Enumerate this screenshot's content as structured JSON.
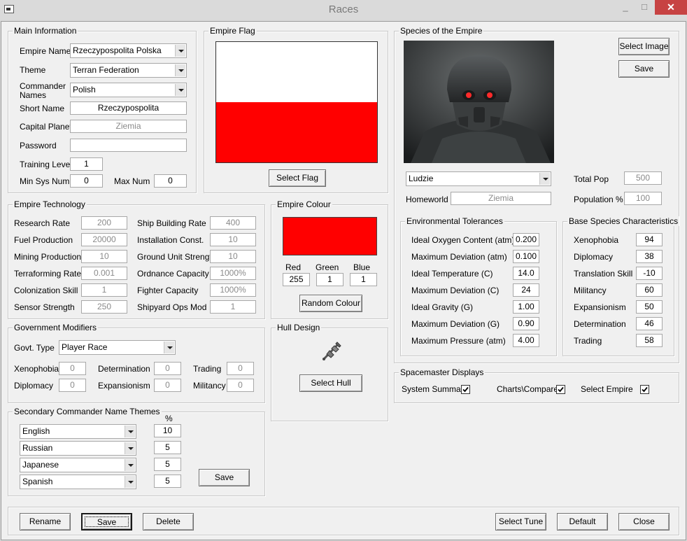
{
  "window": {
    "title": "Races",
    "minimize": "_",
    "maximize": "□",
    "close": "✕"
  },
  "main_info": {
    "title": "Main Information",
    "empire_name_label": "Empire Name",
    "empire_name": "Rzeczypospolita Polska",
    "theme_label": "Theme",
    "theme": "Terran Federation",
    "commander_names_label_1": "Commander",
    "commander_names_label_2": "Names",
    "commander_names": "Polish",
    "short_name_label": "Short Name",
    "short_name": "Rzeczypospolita",
    "capital_label": "Capital Planet",
    "capital": "Ziemia",
    "password_label": "Password",
    "password": "",
    "training_label": "Training Level",
    "training": "1",
    "min_sys_label": "Min Sys Num",
    "min_sys": "0",
    "max_num_label": "Max Num",
    "max_num": "0"
  },
  "empire_flag": {
    "title": "Empire Flag",
    "select_button": "Select Flag",
    "colors": {
      "top": "#ffffff",
      "bottom": "#ff0000"
    }
  },
  "species": {
    "title": "Species of the Empire",
    "select_image_button": "Select Image",
    "save_button": "Save",
    "image_icon": "armored-soldier-portrait",
    "species_name": "Ludzie",
    "homeworld_label": "Homeworld",
    "homeworld": "Ziemia",
    "total_pop_label": "Total Pop",
    "total_pop": "500",
    "population_pct_label": "Population %",
    "population_pct": "100"
  },
  "env_tolerances": {
    "title": "Environmental Tolerances",
    "rows": [
      {
        "label": "Ideal Oxygen Content (atm)",
        "value": "0.200"
      },
      {
        "label": "Maximum Deviation (atm)",
        "value": "0.100"
      },
      {
        "label": "Ideal Temperature (C)",
        "value": "14.0"
      },
      {
        "label": "Maximum Deviation (C)",
        "value": "24"
      },
      {
        "label": "Ideal Gravity (G)",
        "value": "1.00"
      },
      {
        "label": "Maximum Deviation (G)",
        "value": "0.90"
      },
      {
        "label": "Maximum Pressure (atm)",
        "value": "4.00"
      }
    ]
  },
  "base_species": {
    "title": "Base Species Characteristics",
    "rows": [
      {
        "label": "Xenophobia",
        "value": "94"
      },
      {
        "label": "Diplomacy",
        "value": "38"
      },
      {
        "label": "Translation Skill",
        "value": "-10"
      },
      {
        "label": "Militancy",
        "value": "60"
      },
      {
        "label": "Expansionism",
        "value": "50"
      },
      {
        "label": "Determination",
        "value": "46"
      },
      {
        "label": "Trading",
        "value": "58"
      }
    ]
  },
  "tech": {
    "title": "Empire Technology",
    "left": [
      {
        "label": "Research Rate",
        "value": "200"
      },
      {
        "label": "Fuel Production",
        "value": "20000"
      },
      {
        "label": "Mining Production",
        "value": "10"
      },
      {
        "label": "Terraforming Rate",
        "value": "0.001"
      },
      {
        "label": "Colonization Skill",
        "value": "1"
      },
      {
        "label": "Sensor Strength",
        "value": "250"
      }
    ],
    "right": [
      {
        "label": "Ship Building Rate",
        "value": "400"
      },
      {
        "label": "Installation Const.",
        "value": "10"
      },
      {
        "label": "Ground Unit Strength",
        "value": "10"
      },
      {
        "label": "Ordnance Capacity",
        "value": "1000%"
      },
      {
        "label": "Fighter Capacity",
        "value": "1000%"
      },
      {
        "label": "Shipyard Ops Mod",
        "value": "1"
      }
    ]
  },
  "empire_colour": {
    "title": "Empire Colour",
    "swatch_color": "#ff0000",
    "red_label": "Red",
    "red": "255",
    "green_label": "Green",
    "green": "1",
    "blue_label": "Blue",
    "blue": "1",
    "random_button": "Random Colour"
  },
  "gov": {
    "title": "Government Modifiers",
    "type_label": "Govt. Type",
    "type": "Player Race",
    "xenophobia_label": "Xenophobia",
    "xenophobia": "0",
    "determination_label": "Determination",
    "determination": "0",
    "trading_label": "Trading",
    "trading": "0",
    "diplomacy_label": "Diplomacy",
    "diplomacy": "0",
    "expansionism_label": "Expansionism",
    "expansionism": "0",
    "militancy_label": "Militancy",
    "militancy": "0"
  },
  "hull": {
    "title": "Hull Design",
    "select_button": "Select Hull",
    "icon": "starship-hull-icon"
  },
  "secondary": {
    "title": "Secondary Commander Name Themes",
    "pct_header": "%",
    "rows": [
      {
        "name": "English",
        "pct": "10"
      },
      {
        "name": "Russian",
        "pct": "5"
      },
      {
        "name": "Japanese",
        "pct": "5"
      },
      {
        "name": "Spanish",
        "pct": "5"
      }
    ],
    "save_button": "Save"
  },
  "spacemaster": {
    "title": "Spacemaster Displays",
    "system_summary": "System Summary",
    "system_summary_checked": true,
    "charts_compare": "Charts\\Compare",
    "charts_compare_checked": true,
    "select_empire": "Select Empire",
    "select_empire_checked": true
  },
  "bottom": {
    "rename": "Rename",
    "save": "Save",
    "delete": "Delete",
    "select_tune": "Select Tune",
    "default": "Default",
    "close": "Close"
  }
}
